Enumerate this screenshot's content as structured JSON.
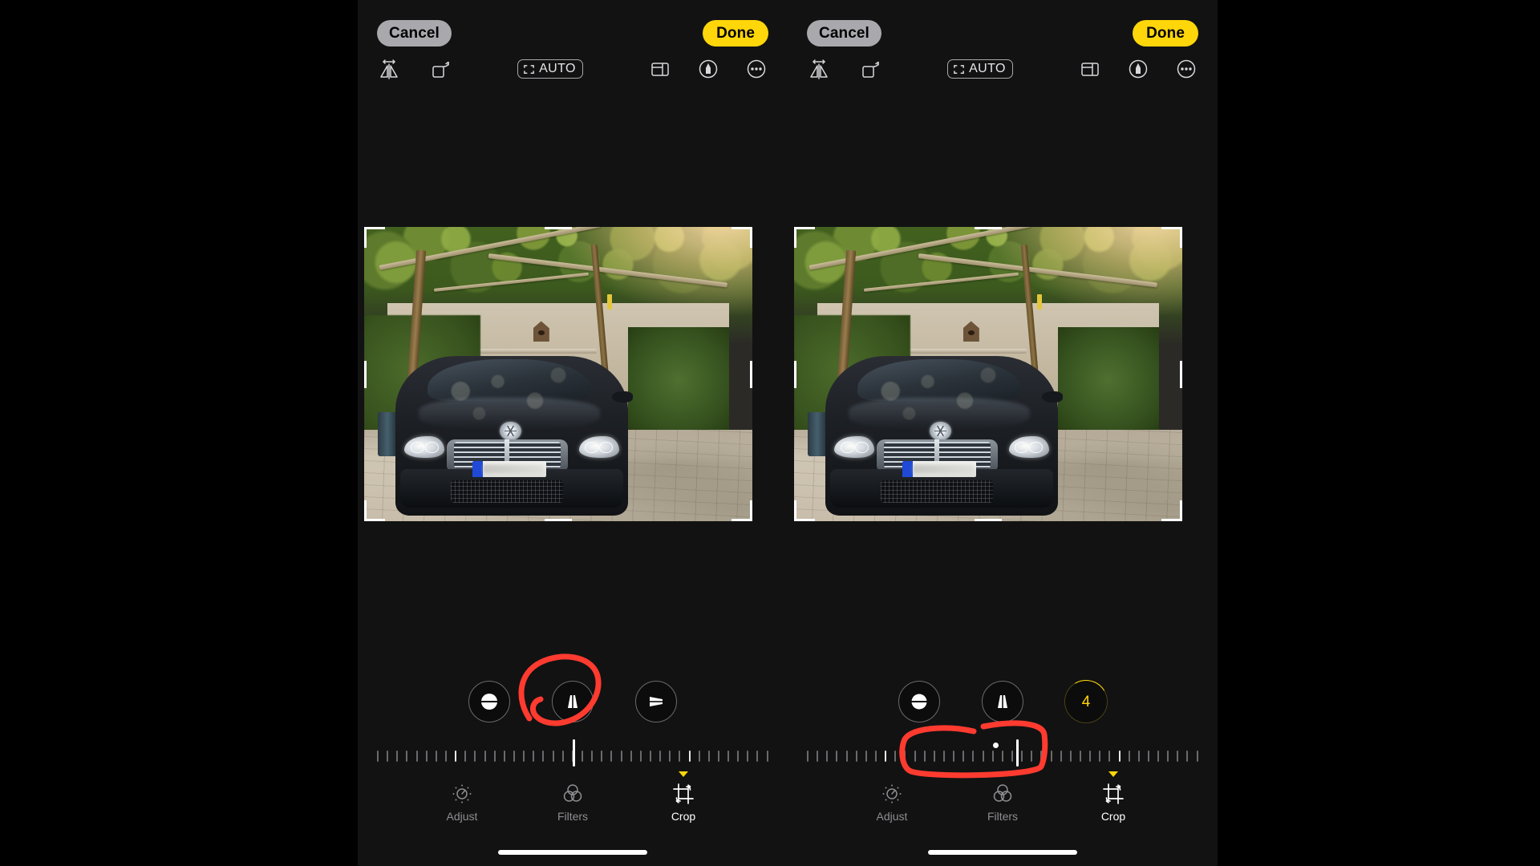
{
  "meta": {
    "app": "Photos Editor",
    "screen": "Crop / Straighten",
    "accent_yellow": "#ffd60a",
    "annotation_red": "#ff3b30",
    "background": "#000000",
    "phone_background": "#121212"
  },
  "panels": [
    {
      "id": "left",
      "nav": {
        "cancel_label": "Cancel",
        "done_label": "Done"
      },
      "toolbar": {
        "flip_icon": "flip-horizontal-icon",
        "rotate_icon": "rotate-left-icon",
        "auto_label": "AUTO",
        "auto_icon": "auto-crop-icon",
        "aspect_icon": "aspect-ratio-icon",
        "markup_icon": "markup-pen-icon",
        "more_icon": "more-options-icon"
      },
      "straighten": {
        "controls": [
          {
            "name": "straighten-button",
            "icon": "straighten-icon",
            "value": null,
            "selected": false
          },
          {
            "name": "vertical-perspective-button",
            "icon": "vertical-perspective-icon",
            "value": null,
            "selected": false
          },
          {
            "name": "horizontal-perspective-button",
            "icon": "horizontal-perspective-icon",
            "value": null,
            "selected": false
          }
        ]
      },
      "ruler": {
        "tick_count": 41,
        "bright_tick_indices": [
          8,
          32
        ],
        "indicator_percent": 50,
        "show_zero_dot": false,
        "zero_dot_percent": 50
      },
      "tabs": [
        {
          "label": "Adjust",
          "icon": "adjust-dial-icon",
          "selected": false
        },
        {
          "label": "Filters",
          "icon": "filters-circles-icon",
          "selected": false
        },
        {
          "label": "Crop",
          "icon": "crop-rotate-icon",
          "selected": true
        }
      ],
      "annotation": {
        "shape": "circle-around-horizontal-perspective-button",
        "color": "#ff3b30"
      }
    },
    {
      "id": "right",
      "nav": {
        "cancel_label": "Cancel",
        "done_label": "Done"
      },
      "toolbar": {
        "flip_icon": "flip-horizontal-icon",
        "rotate_icon": "rotate-left-icon",
        "auto_label": "AUTO",
        "auto_icon": "auto-crop-icon",
        "aspect_icon": "aspect-ratio-icon",
        "markup_icon": "markup-pen-icon",
        "more_icon": "more-options-icon"
      },
      "straighten": {
        "controls": [
          {
            "name": "straighten-button",
            "icon": "straighten-icon",
            "value": null,
            "selected": false
          },
          {
            "name": "vertical-perspective-button",
            "icon": "vertical-perspective-icon",
            "value": null,
            "selected": false
          },
          {
            "name": "horizontal-perspective-button",
            "icon": "horizontal-perspective-icon",
            "value": "4",
            "selected": true
          }
        ],
        "active_value": "4"
      },
      "ruler": {
        "tick_count": 41,
        "bright_tick_indices": [
          8,
          32
        ],
        "indicator_percent": 53.5,
        "show_zero_dot": true,
        "zero_dot_percent": 47.5
      },
      "tabs": [
        {
          "label": "Adjust",
          "icon": "adjust-dial-icon",
          "selected": false
        },
        {
          "label": "Filters",
          "icon": "filters-circles-icon",
          "selected": false
        },
        {
          "label": "Crop",
          "icon": "crop-rotate-icon",
          "selected": true
        }
      ],
      "annotation": {
        "shape": "rounded-box-around-ruler-center",
        "color": "#ff3b30"
      }
    }
  ],
  "photo": {
    "description": "Dark Mercedes-Benz S-Class sedan parked under a green vine-covered pergola, beige stone wall behind, paved stone ground",
    "license_plate_blurred": true
  }
}
